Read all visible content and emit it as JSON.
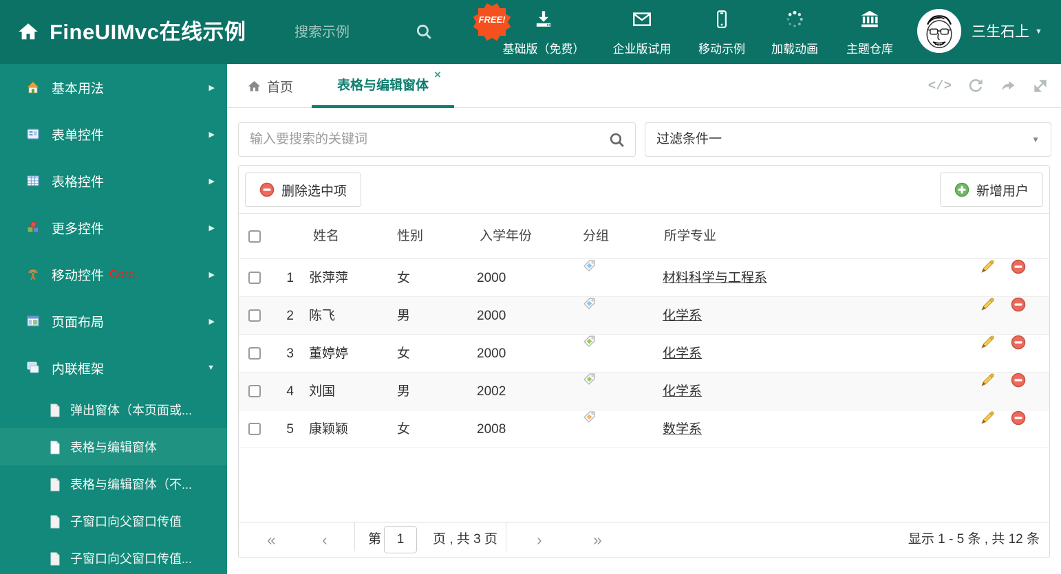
{
  "colors": {
    "header_bg": "#0B7265",
    "sidebar_bg": "#12897A",
    "selected_bg": "#1F9282",
    "accent": "#0E7E6F",
    "free_badge": "#F4511E",
    "tag_blue": "#8CC8F4",
    "tag_green": "#9CCB62",
    "tag_orange": "#F9B36B",
    "corp_red": "#FF1A1A"
  },
  "icons": {
    "caret_down": "▼",
    "caret_right": "▶",
    "close": "×",
    "code": "</>"
  },
  "header": {
    "title": "FineUIMvc在线示例",
    "search_placeholder": "搜索示例",
    "free_badge": "FREE!",
    "nav_items": [
      {
        "label": "基础版（免费）"
      },
      {
        "label": "企业版试用"
      },
      {
        "label": "移动示例"
      },
      {
        "label": "加载动画"
      },
      {
        "label": "主题仓库"
      }
    ],
    "user_name": "三生石上"
  },
  "sidebar": {
    "items": [
      {
        "label": "基本用法"
      },
      {
        "label": "表单控件"
      },
      {
        "label": "表格控件"
      },
      {
        "label": "更多控件"
      },
      {
        "label": "移动控件",
        "badge": "Corp."
      },
      {
        "label": "页面布局"
      },
      {
        "label": "内联框架"
      }
    ],
    "subitems": [
      {
        "label": "弹出窗体（本页面或..."
      },
      {
        "label": "表格与编辑窗体"
      },
      {
        "label": "表格与编辑窗体（不..."
      },
      {
        "label": "子窗口向父窗口传值"
      },
      {
        "label": "子窗口向父窗口传值..."
      }
    ]
  },
  "tabs": [
    {
      "label": "首页"
    },
    {
      "label": "表格与编辑窗体"
    }
  ],
  "filters": {
    "search_placeholder": "输入要搜索的关键词",
    "filter_value": "过滤条件一"
  },
  "toolbar": {
    "delete_label": "删除选中项",
    "add_label": "新增用户"
  },
  "table": {
    "columns": [
      "姓名",
      "性别",
      "入学年份",
      "分组",
      "所学专业"
    ],
    "rows": [
      {
        "num": "1",
        "name": "张萍萍",
        "gender": "女",
        "year": "2000",
        "tag": "tag-blue",
        "major": "材料科学与工程系"
      },
      {
        "num": "2",
        "name": "陈飞",
        "gender": "男",
        "year": "2000",
        "tag": "tag-blue",
        "major": "化学系"
      },
      {
        "num": "3",
        "name": "董婷婷",
        "gender": "女",
        "year": "2000",
        "tag": "tag-green",
        "major": "化学系"
      },
      {
        "num": "4",
        "name": "刘国",
        "gender": "男",
        "year": "2002",
        "tag": "tag-green",
        "major": "化学系"
      },
      {
        "num": "5",
        "name": "康颖颖",
        "gender": "女",
        "year": "2008",
        "tag": "tag-orange",
        "major": "数学系"
      }
    ]
  },
  "pager": {
    "first": "«",
    "prev": "‹",
    "label_prefix": "第",
    "page_value": "1",
    "label_suffix": "页 , 共 3 页",
    "next": "›",
    "last": "»",
    "summary": "显示 1 - 5 条 , 共 12 条"
  }
}
